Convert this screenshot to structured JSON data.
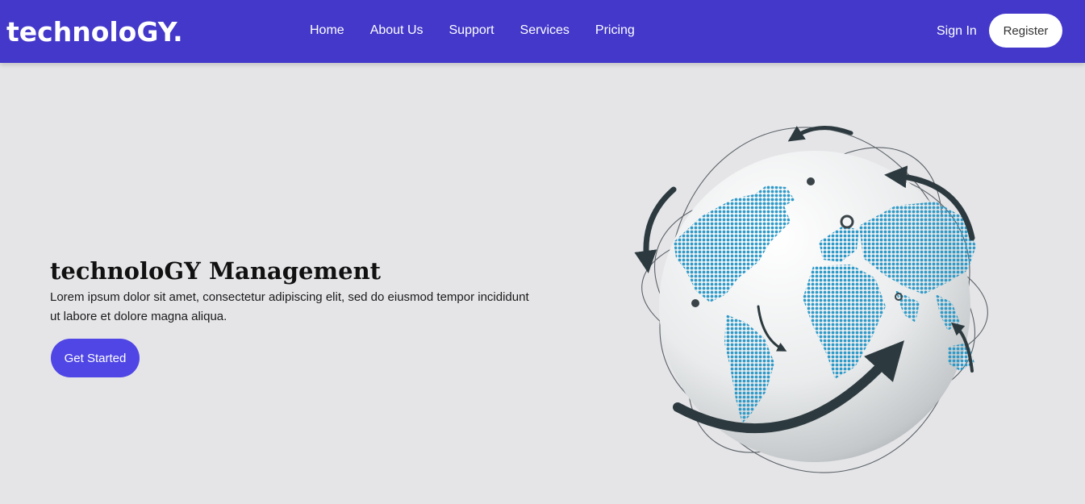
{
  "brand": {
    "logo_text": "technoloGY."
  },
  "nav": {
    "links": [
      "Home",
      "About Us",
      "Support",
      "Services",
      "Pricing"
    ],
    "sign_in": "Sign In",
    "register": "Register"
  },
  "hero": {
    "title": "technoloGY Management",
    "description": "Lorem ipsum dolor sit amet, consectetur adipiscing elit, sed do eiusmod tempor incididunt ut labore et dolore magna aliqua.",
    "cta": "Get Started"
  },
  "colors": {
    "nav_bg": "#4338ca",
    "cta_bg": "#4f46e5",
    "page_bg": "#e5e5e8",
    "map_dots": "#2e9ac8",
    "arrows": "#2c3a3f"
  },
  "illustration": {
    "icon": "globe-network-icon"
  }
}
